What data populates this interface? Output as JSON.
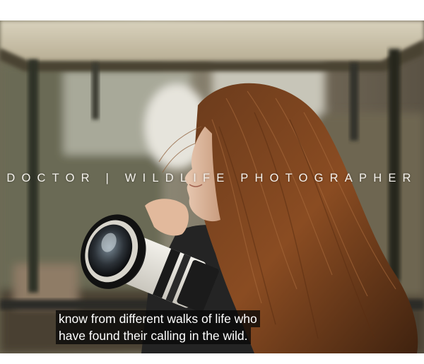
{
  "video": {
    "title_overlay": "DOCTOR | WILDLIFE PHOTOGRAPHER",
    "captions": [
      "know from different walks of life who",
      "have found their calling in the wild."
    ]
  },
  "colors": {
    "title_text": "#f4f1ec",
    "caption_text": "#ffffff",
    "caption_background": "#080808"
  }
}
